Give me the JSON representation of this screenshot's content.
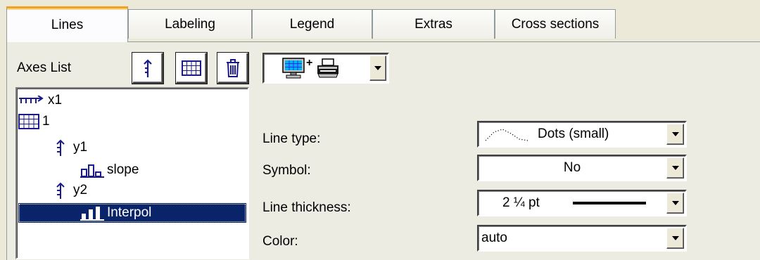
{
  "tabs": [
    "Lines",
    "Labeling",
    "Legend",
    "Extras",
    "Cross sections"
  ],
  "active_tab": "Lines",
  "axes_list": {
    "label": "Axes List",
    "toolbar_icons": [
      "add-y-axis-icon",
      "add-coordinate-system-icon",
      "delete-icon"
    ]
  },
  "device_selector": {
    "icons": [
      "monitor-icon",
      "printer-icon"
    ],
    "separator": "+"
  },
  "tree": [
    {
      "label": "x1",
      "icon": "x-axis-icon"
    },
    {
      "label": "1",
      "icon": "coordinate-system-icon"
    },
    {
      "label": "y1",
      "icon": "y-axis-icon"
    },
    {
      "label": "slope",
      "icon": "channel-icon"
    },
    {
      "label": "y2",
      "icon": "y-axis-icon"
    },
    {
      "label": "Interpol",
      "icon": "channel-icon",
      "selected": true
    }
  ],
  "properties": {
    "line_type": {
      "label": "Line type:",
      "value": "Dots (small)"
    },
    "symbol": {
      "label": "Symbol:",
      "value": "No"
    },
    "line_thickness": {
      "label": "Line thickness:",
      "value": "2 ¼ pt"
    },
    "color": {
      "label": "Color:",
      "value": "auto"
    }
  },
  "colors": {
    "selection": "#0a246a",
    "active_tab_accent": "#f3a221",
    "background": "#ece9d8",
    "icon_blue": "#1a1a8c"
  }
}
